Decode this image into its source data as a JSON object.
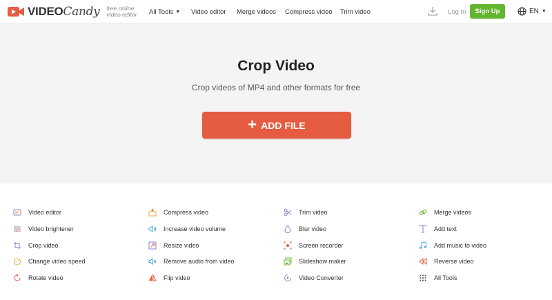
{
  "header": {
    "logo_video": "VIDEO",
    "logo_candy": "Candy",
    "tagline_line1": "free online",
    "tagline_line2": "video editor",
    "nav": [
      {
        "label": "All Tools",
        "has_caret": true
      },
      {
        "label": "Video editor"
      },
      {
        "label": "Merge videos"
      },
      {
        "label": "Compress video"
      },
      {
        "label": "Trim video"
      }
    ],
    "login_label": "Log In",
    "signup_label": "Sign Up",
    "language": "EN",
    "brand_color": "#e55c41",
    "signup_color": "#62b52f"
  },
  "hero": {
    "title": "Crop Video",
    "subtitle": "Crop videos of MP4 and other formats for free",
    "add_file_label": "ADD FILE"
  },
  "tools": {
    "col1": [
      {
        "label": "Video editor",
        "icon": "video-editor-icon"
      },
      {
        "label": "Video brightener",
        "icon": "brightener-icon"
      },
      {
        "label": "Crop video",
        "icon": "crop-icon"
      },
      {
        "label": "Change video speed",
        "icon": "speed-icon"
      },
      {
        "label": "Rotate video",
        "icon": "rotate-icon"
      }
    ],
    "col2": [
      {
        "label": "Compress video",
        "icon": "compress-icon"
      },
      {
        "label": "Increase video volume",
        "icon": "volume-icon"
      },
      {
        "label": "Resize video",
        "icon": "resize-icon"
      },
      {
        "label": "Remove audio from video",
        "icon": "mute-icon"
      },
      {
        "label": "Flip video",
        "icon": "flip-icon"
      }
    ],
    "col3": [
      {
        "label": "Trim video",
        "icon": "scissors-icon"
      },
      {
        "label": "Blur video",
        "icon": "blur-drop-icon"
      },
      {
        "label": "Screen recorder",
        "icon": "screen-recorder-icon"
      },
      {
        "label": "Slideshow maker",
        "icon": "slideshow-icon"
      },
      {
        "label": "Video Converter",
        "icon": "converter-icon"
      }
    ],
    "col4": [
      {
        "label": "Merge videos",
        "icon": "merge-icon"
      },
      {
        "label": "Add text",
        "icon": "text-icon"
      },
      {
        "label": "Add music to video",
        "icon": "music-icon"
      },
      {
        "label": "Reverse video",
        "icon": "reverse-icon"
      },
      {
        "label": "All Tools",
        "icon": "grid-icon"
      }
    ]
  }
}
